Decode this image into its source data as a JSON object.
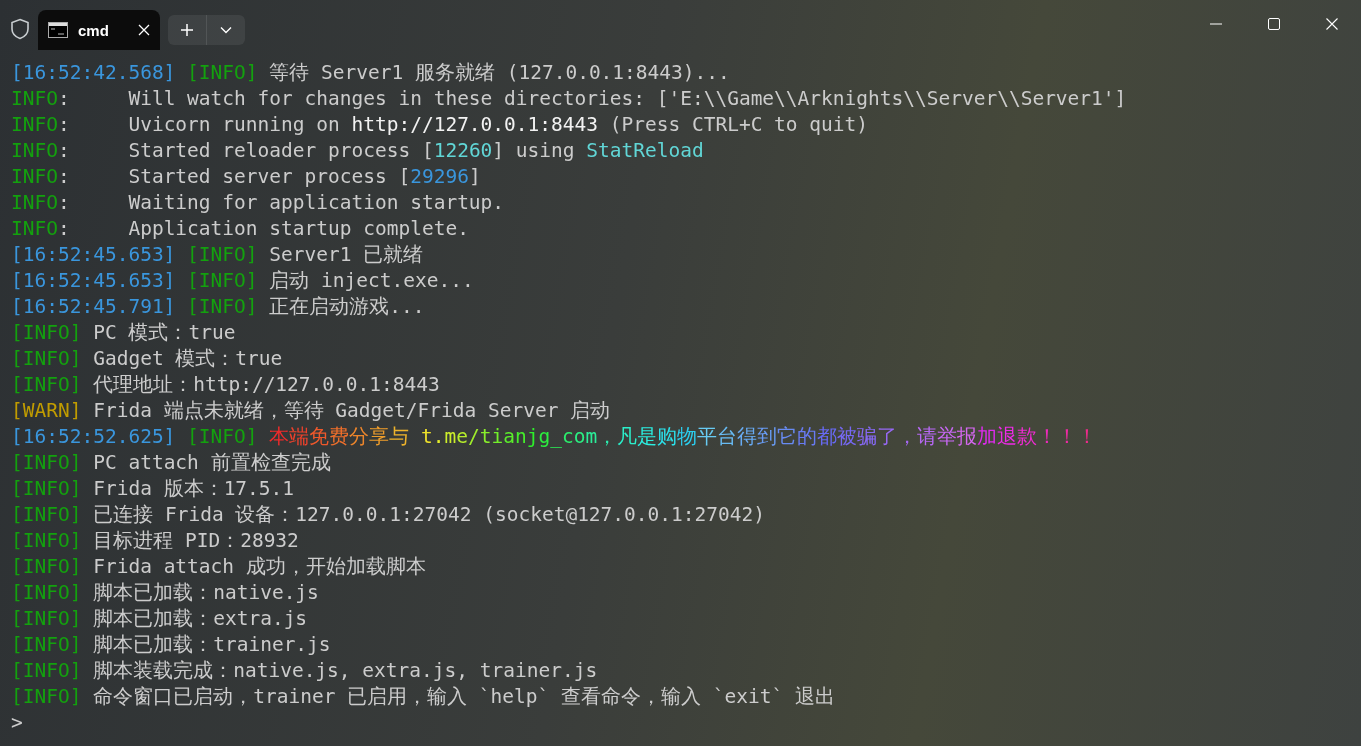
{
  "window": {
    "tab": {
      "title": "cmd",
      "selected": true
    }
  },
  "lines": [
    [
      {
        "text": "[16:52:42.568] ",
        "color": "#3a96dd"
      },
      {
        "text": "[INFO]",
        "color": "#13a10e"
      },
      {
        "text": " 等待 Server1 服务就绪 (127.0.0.1:8443)..."
      }
    ],
    [
      {
        "text": "INFO",
        "color": "#13a10e"
      },
      {
        "text": ":     Will watch for changes in these directories: ['E:\\\\Game\\\\Arknights\\\\Server\\\\Server1']"
      }
    ],
    [
      {
        "text": "INFO",
        "color": "#13a10e"
      },
      {
        "text": ":     Uvicorn running on "
      },
      {
        "text": "http://127.0.0.1:8443",
        "color": "#f2f2f2"
      },
      {
        "text": " (Press CTRL+C to quit)"
      }
    ],
    [
      {
        "text": "INFO",
        "color": "#13a10e"
      },
      {
        "text": ":     Started reloader process ["
      },
      {
        "text": "12260",
        "color": "#61d6d6"
      },
      {
        "text": "] using "
      },
      {
        "text": "StatReload",
        "color": "#61d6d6"
      }
    ],
    [
      {
        "text": "INFO",
        "color": "#13a10e"
      },
      {
        "text": ":     Started server process ["
      },
      {
        "text": "29296",
        "color": "#3a96dd"
      },
      {
        "text": "]"
      }
    ],
    [
      {
        "text": "INFO",
        "color": "#13a10e"
      },
      {
        "text": ":     Waiting for application startup."
      }
    ],
    [
      {
        "text": "INFO",
        "color": "#13a10e"
      },
      {
        "text": ":     Application startup complete."
      }
    ],
    [
      {
        "text": "[16:52:45.653] ",
        "color": "#3a96dd"
      },
      {
        "text": "[INFO]",
        "color": "#13a10e"
      },
      {
        "text": " Server1 已就绪"
      }
    ],
    [
      {
        "text": "[16:52:45.653] ",
        "color": "#3a96dd"
      },
      {
        "text": "[INFO]",
        "color": "#13a10e"
      },
      {
        "text": " 启动 inject.exe..."
      }
    ],
    [
      {
        "text": "[16:52:45.791] ",
        "color": "#3a96dd"
      },
      {
        "text": "[INFO]",
        "color": "#13a10e"
      },
      {
        "text": " 正在启动游戏..."
      }
    ],
    [
      {
        "text": "[INFO]",
        "color": "#13a10e"
      },
      {
        "text": " PC 模式：true"
      }
    ],
    [
      {
        "text": "[INFO]",
        "color": "#13a10e"
      },
      {
        "text": " Gadget 模式：true"
      }
    ],
    [
      {
        "text": "[INFO]",
        "color": "#13a10e"
      },
      {
        "text": " 代理地址：http://127.0.0.1:8443"
      }
    ],
    [
      {
        "text": "[WARN]",
        "color": "#c19c00"
      },
      {
        "text": " Frida 端点未就绪，等待 Gadget/Frida Server 启动"
      }
    ],
    [
      {
        "text": "[16:52:52.625] ",
        "color": "#3a96dd"
      },
      {
        "text": "[INFO] ",
        "color": "#13a10e"
      },
      {
        "text": "本端免费分享与 t.me/tianjg_com，凡是购物平台得到它的都被骗了，请举报加退款！！！",
        "kind": "rainbow"
      }
    ],
    [
      {
        "text": "[INFO]",
        "color": "#13a10e"
      },
      {
        "text": " PC attach 前置检查完成"
      }
    ],
    [
      {
        "text": "[INFO]",
        "color": "#13a10e"
      },
      {
        "text": " Frida 版本：17.5.1"
      }
    ],
    [
      {
        "text": "[INFO]",
        "color": "#13a10e"
      },
      {
        "text": " 已连接 Frida 设备：127.0.0.1:27042 (socket@127.0.0.1:27042)"
      }
    ],
    [
      {
        "text": "[INFO]",
        "color": "#13a10e"
      },
      {
        "text": " 目标进程 PID：28932"
      }
    ],
    [
      {
        "text": "[INFO]",
        "color": "#13a10e"
      },
      {
        "text": " Frida attach 成功，开始加载脚本"
      }
    ],
    [
      {
        "text": "[INFO]",
        "color": "#13a10e"
      },
      {
        "text": " 脚本已加载：native.js"
      }
    ],
    [
      {
        "text": "[INFO]",
        "color": "#13a10e"
      },
      {
        "text": " 脚本已加载：extra.js"
      }
    ],
    [
      {
        "text": "[INFO]",
        "color": "#13a10e"
      },
      {
        "text": " 脚本已加载：trainer.js"
      }
    ],
    [
      {
        "text": "[INFO]",
        "color": "#13a10e"
      },
      {
        "text": " 脚本装载完成：native.js, extra.js, trainer.js"
      }
    ],
    [
      {
        "text": "[INFO]",
        "color": "#13a10e"
      },
      {
        "text": " 命令窗口已启动，trainer 已启用，输入 `help` 查看命令，输入 `exit` 退出"
      }
    ]
  ],
  "prompt": ">"
}
